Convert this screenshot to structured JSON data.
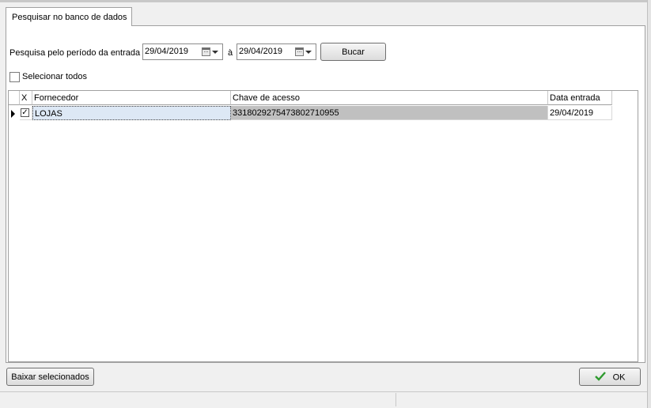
{
  "tab": {
    "label": "Pesquisar no banco de dados"
  },
  "filter": {
    "period_label": "Pesquisa pelo período da entrada",
    "date_from": "29/04/2019",
    "separator": "à",
    "date_to": "29/04/2019",
    "search_button": "Bucar"
  },
  "select_all": {
    "label": "Selecionar todos",
    "checked": false
  },
  "grid": {
    "columns": [
      "X",
      "Fornecedor",
      "Chave de acesso",
      "Data entrada"
    ],
    "rows": [
      {
        "checked": true,
        "fornecedor": "LOJAS",
        "chave": "3318029275473802710955",
        "data": "29/04/2019"
      }
    ]
  },
  "footer": {
    "download_button": "Baixar selecionados",
    "ok_button": "OK"
  },
  "colors": {
    "ok_check": "#2e9a2e",
    "selected_cell": "#c0c0c0",
    "focus_cell": "#dde8f5"
  }
}
